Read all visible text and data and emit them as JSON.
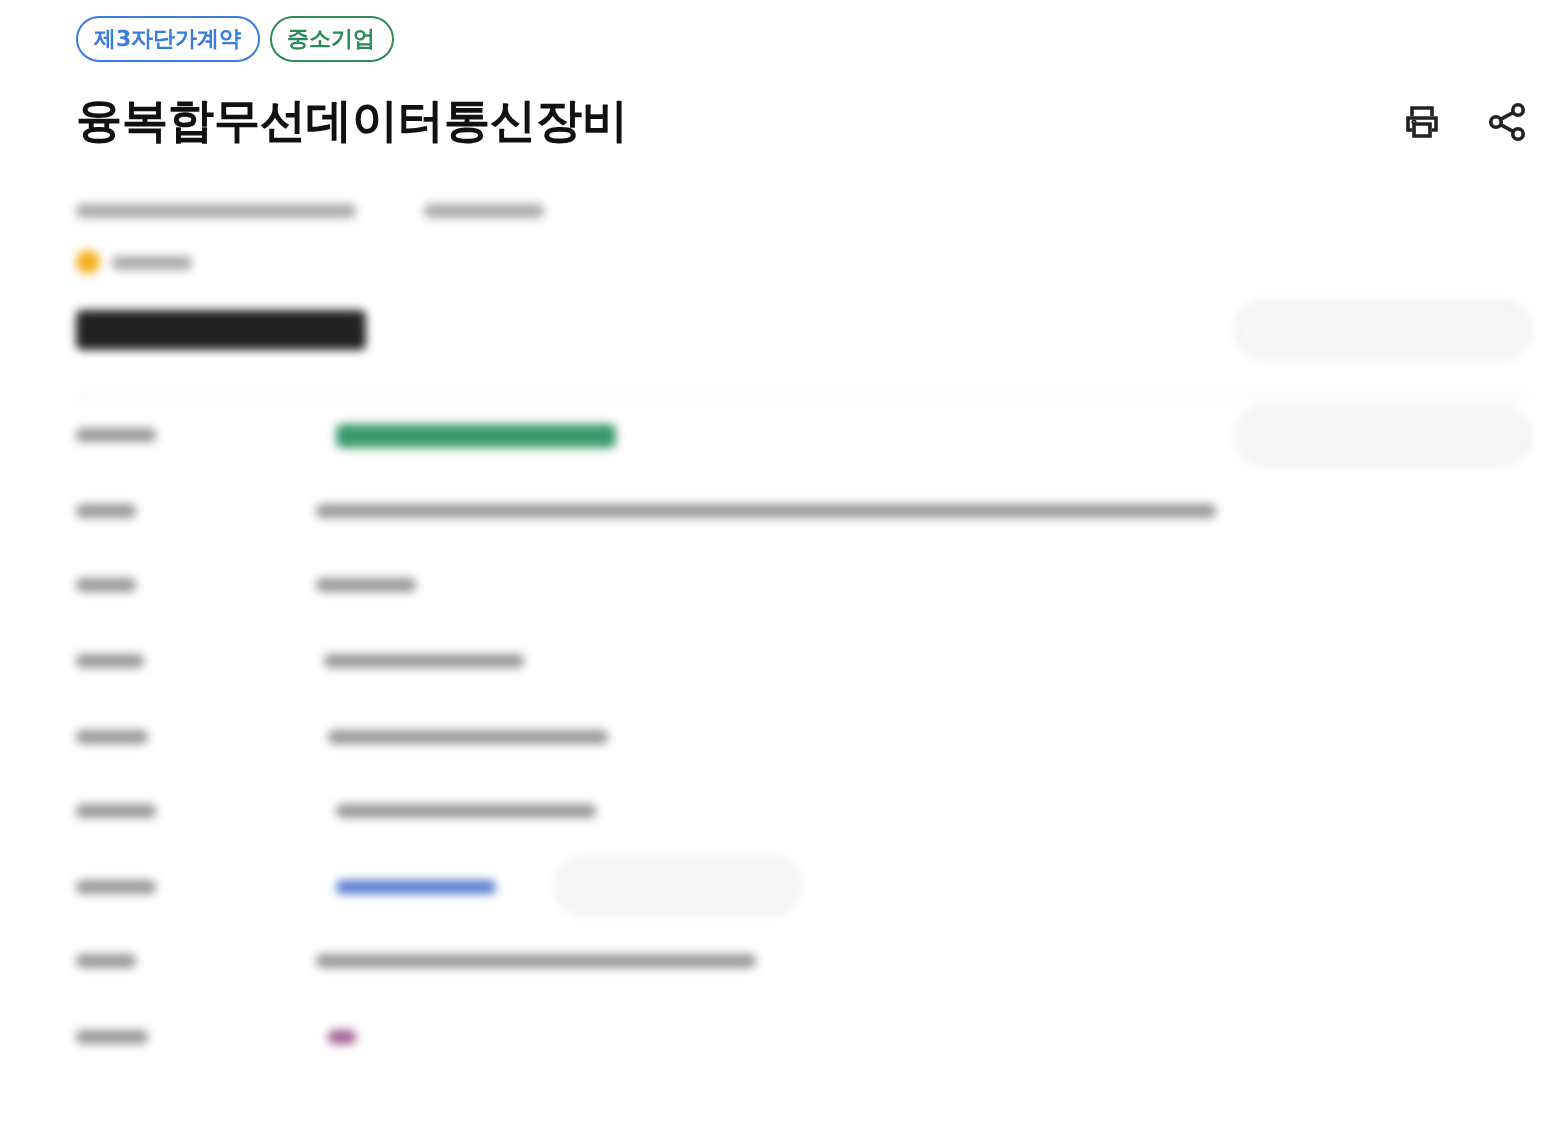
{
  "badges": [
    {
      "label": "제3자단가계약",
      "color": "#3b7ddd"
    },
    {
      "label": "중소기업",
      "color": "#2e8b57"
    }
  ],
  "title": "융복합무선데이터통신장비"
}
